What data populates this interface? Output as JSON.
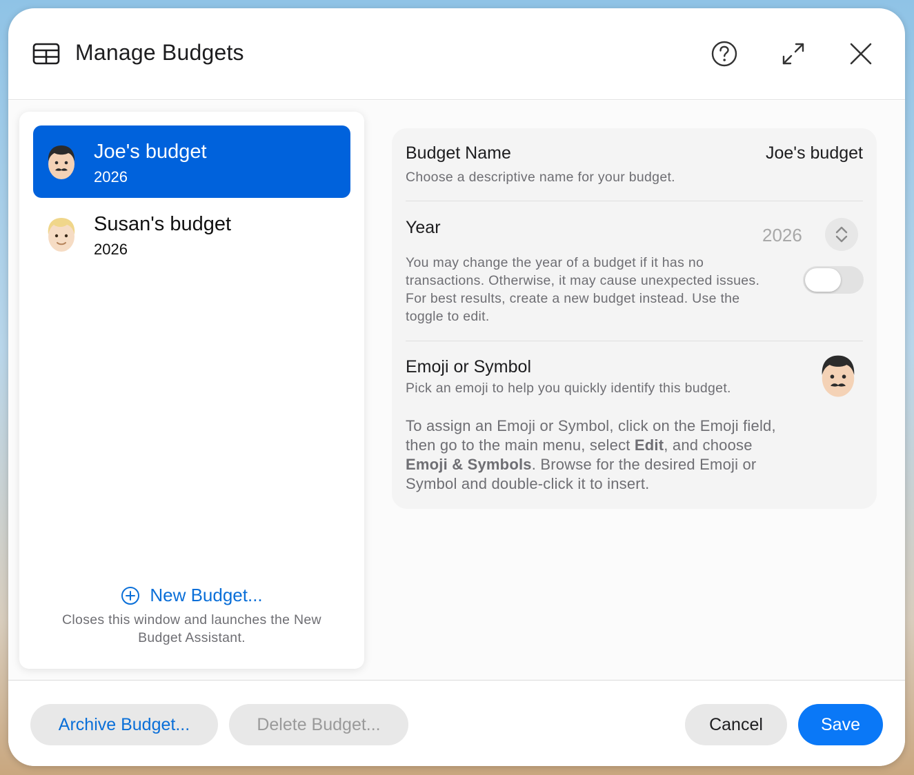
{
  "window": {
    "title": "Manage Budgets",
    "icons": {
      "title": "table-icon",
      "help": "question-circle-icon",
      "expand": "expand-arrows-icon",
      "close": "close-icon"
    }
  },
  "sidebar": {
    "budgets": [
      {
        "name": "Joe's budget",
        "year": "2026",
        "selected": true,
        "avatar": "man-mustache-emoji"
      },
      {
        "name": "Susan's budget",
        "year": "2026",
        "selected": false,
        "avatar": "blond-person-emoji"
      }
    ],
    "new_budget": {
      "label": "New Budget...",
      "icon": "plus-circle-icon",
      "description": "Closes this window and launches the New Budget Assistant."
    }
  },
  "settings": {
    "budget_name": {
      "label": "Budget Name",
      "description": "Choose a descriptive name for your budget.",
      "value": "Joe's budget"
    },
    "year": {
      "label": "Year",
      "value": "2026",
      "description": "You may change the year of a budget if it has no transactions. Otherwise, it may cause unexpected issues. For best results, create a new budget instead. Use the toggle to edit.",
      "toggle_on": false
    },
    "emoji": {
      "label": "Emoji or Symbol",
      "description": "Pick an emoji to help you quickly identify this budget.",
      "help_parts": [
        "To assign an Emoji or Symbol, click on the Emoji field, then go to the main menu, select ",
        "Edit",
        ", and choose ",
        "Emoji & Symbols",
        ". Browse for the desired Emoji or Symbol and double-click it to insert."
      ],
      "value": "man-mustache-emoji"
    }
  },
  "footer": {
    "archive_label": "Archive Budget...",
    "delete_label": "Delete Budget...",
    "cancel_label": "Cancel",
    "save_label": "Save"
  },
  "colors": {
    "accent": "#0062dc",
    "link": "#0a6fd8",
    "save": "#0a78f7"
  }
}
